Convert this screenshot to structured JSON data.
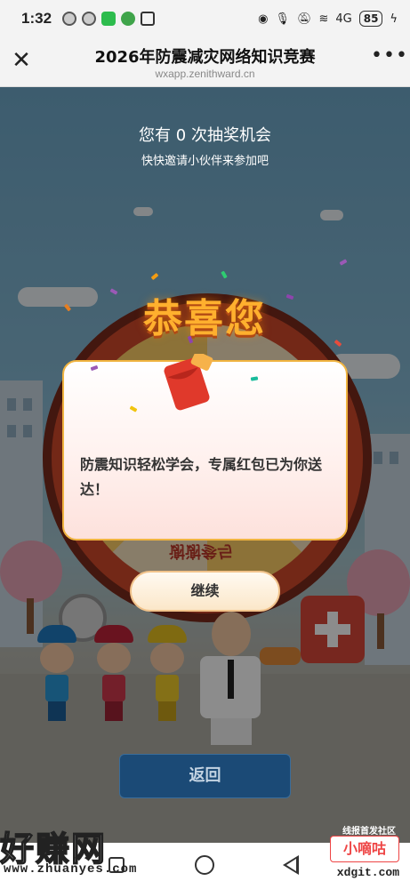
{
  "status_bar": {
    "time": "1:32",
    "network": "4G",
    "battery": "85"
  },
  "header": {
    "title": "2026年防震减灾网络知识竞赛",
    "url": "wxapp.zenithward.cn",
    "close_icon": "close-icon",
    "more_icon": "more-icon"
  },
  "lottery": {
    "chances_text": "您有 0 次抽奖机会",
    "invite_text": "快快邀请小伙伴来参加吧",
    "wheel_prize_mirrored": "谢谢参与"
  },
  "modal": {
    "title": "恭喜您",
    "message": "防震知识轻松学会，专属红包已为你送达！",
    "continue_label": "继续"
  },
  "footer": {
    "back_label": "返回",
    "community_tag": "线报首发社区"
  },
  "watermarks": {
    "left_text": "好赚网",
    "left_url": "www.zhuanyes.com",
    "right_text": "小嘀咕",
    "right_url": "xdgit.com"
  },
  "colors": {
    "accent_gold": "#f0b441",
    "envelope_red": "#e0392b",
    "back_button_bg": "#1b4a76"
  }
}
